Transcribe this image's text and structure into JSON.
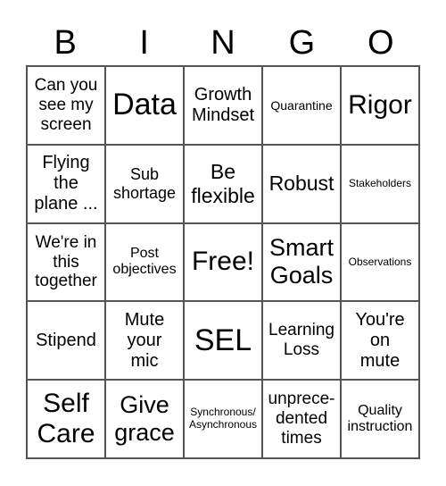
{
  "header": [
    "B",
    "I",
    "N",
    "G",
    "O"
  ],
  "cells": [
    "Can you\nsee my\nscreen",
    "Data",
    "Growth\nMindset",
    "Quarantine",
    "Rigor",
    "Flying\nthe\nplane ...",
    "Sub\nshortage",
    "Be\nflexible",
    "Robust",
    "Stakeholders",
    "We're in\nthis\ntogether",
    "Post\nobjectives",
    "Free!",
    "Smart\nGoals",
    "Observations",
    "Stipend",
    "Mute\nyour\nmic",
    "SEL",
    "Learning\nLoss",
    "You're\non\nmute",
    "Self\nCare",
    "Give\ngrace",
    "Synchronous/\nAsynchronous",
    "unprece-\ndented\ntimes",
    "Quality\ninstruction"
  ]
}
